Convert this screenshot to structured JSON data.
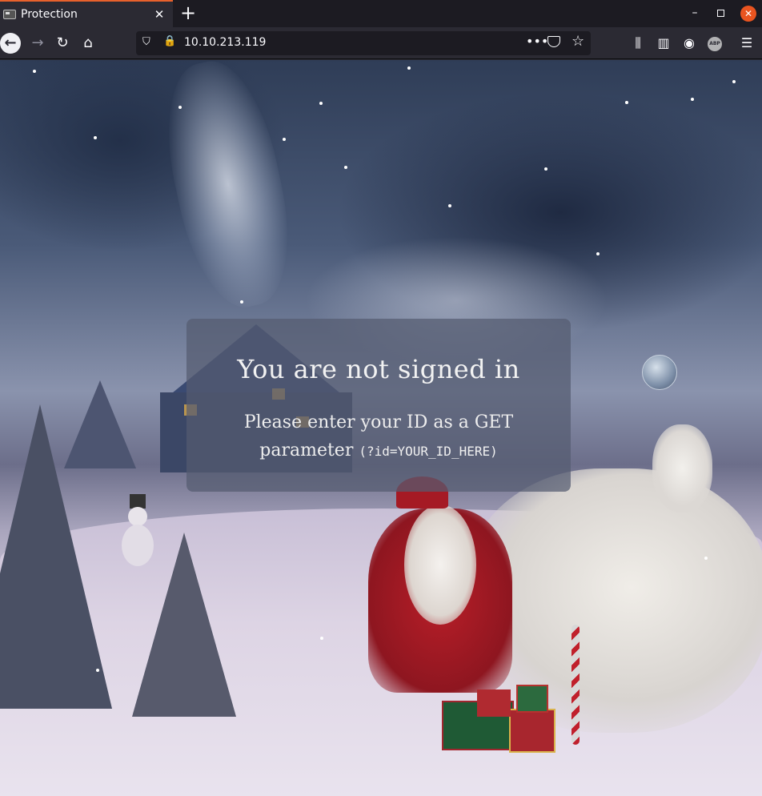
{
  "browser": {
    "tab_title": "Protection",
    "tab_close": "✕",
    "new_tab": "+",
    "url": "10.10.213.119",
    "more_actions": "•••",
    "abp_label": "ABP",
    "window_min": "–",
    "window_close": "✕"
  },
  "page": {
    "heading": "You are not signed in",
    "message_text": "Please enter your ID as a GET parameter",
    "message_code": "(?id=YOUR_ID_HERE)"
  },
  "colors": {
    "tab_accent": "#e8612c",
    "window_close": "#e95420",
    "card_background": "#545c70"
  },
  "icons": [
    "back-arrow-icon",
    "forward-arrow-icon",
    "reload-icon",
    "home-icon",
    "shield-icon",
    "insecure-lock-icon",
    "pocket-icon",
    "star-icon",
    "library-icon",
    "sidebar-icon",
    "account-icon",
    "adblock-icon",
    "hamburger-menu-icon"
  ]
}
